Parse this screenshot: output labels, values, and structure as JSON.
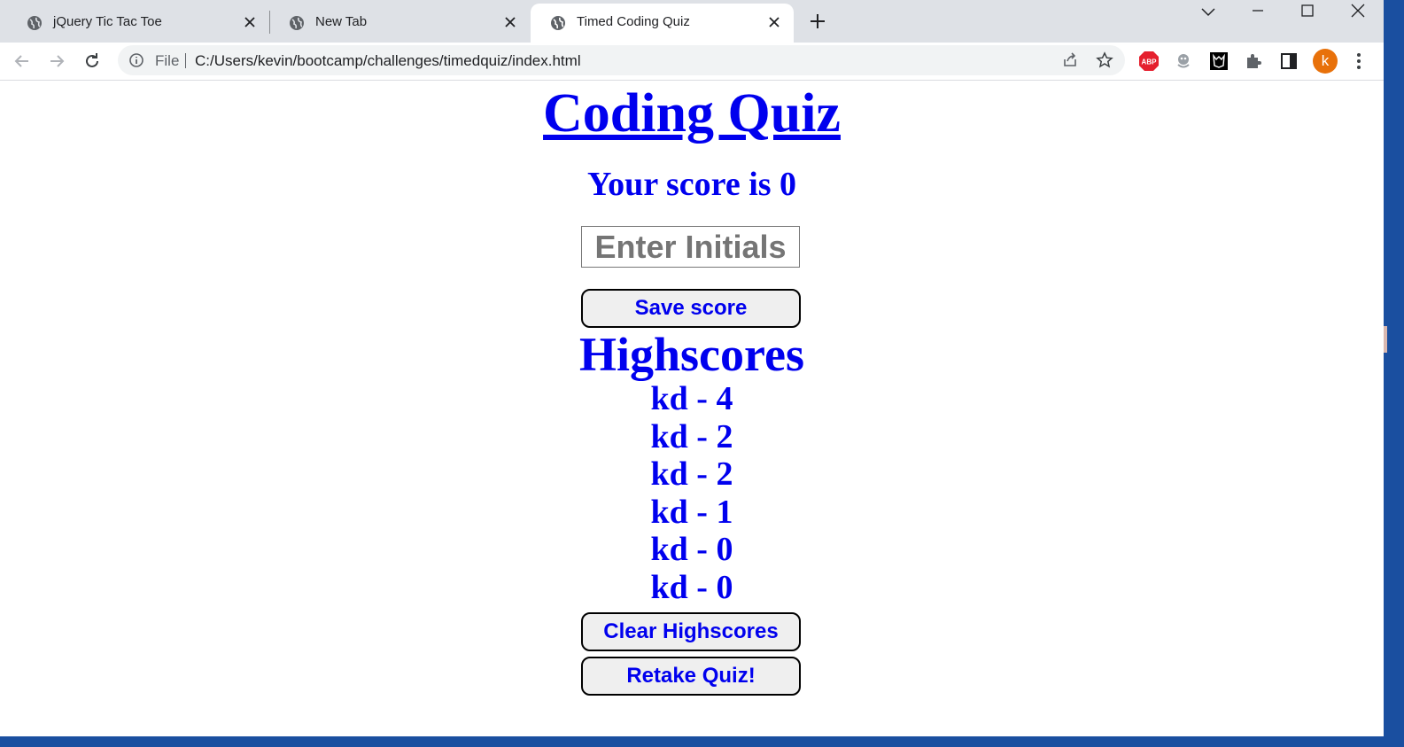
{
  "browser": {
    "tabs": [
      {
        "title": "jQuery Tic Tac Toe",
        "active": false
      },
      {
        "title": "New Tab",
        "active": false
      },
      {
        "title": "Timed Coding Quiz",
        "active": true
      }
    ],
    "omnibox": {
      "scheme_label": "File",
      "url": "C:/Users/kevin/bootcamp/challenges/timedquiz/index.html"
    },
    "profile_initial": "k",
    "extensions": [
      "adblock-plus-icon",
      "extension-icon",
      "wolf-extension-icon",
      "puzzle-extensions-icon",
      "side-panel-icon"
    ]
  },
  "page": {
    "title": "Coding Quiz",
    "score_text": "Your score is 0",
    "initials_placeholder": "Enter Initials",
    "save_button": "Save score",
    "highscores_title": "Highscores",
    "highscores": [
      "kd - 4",
      "kd - 2",
      "kd - 2",
      "kd - 1",
      "kd - 0",
      "kd - 0"
    ],
    "clear_button": "Clear Highscores",
    "retake_button": "Retake Quiz!"
  },
  "colors": {
    "text": "#0000ee",
    "button_bg": "#efefef",
    "tab_strip": "#dee1e6",
    "profile": "#e8710a",
    "abp": "#e5202e"
  }
}
